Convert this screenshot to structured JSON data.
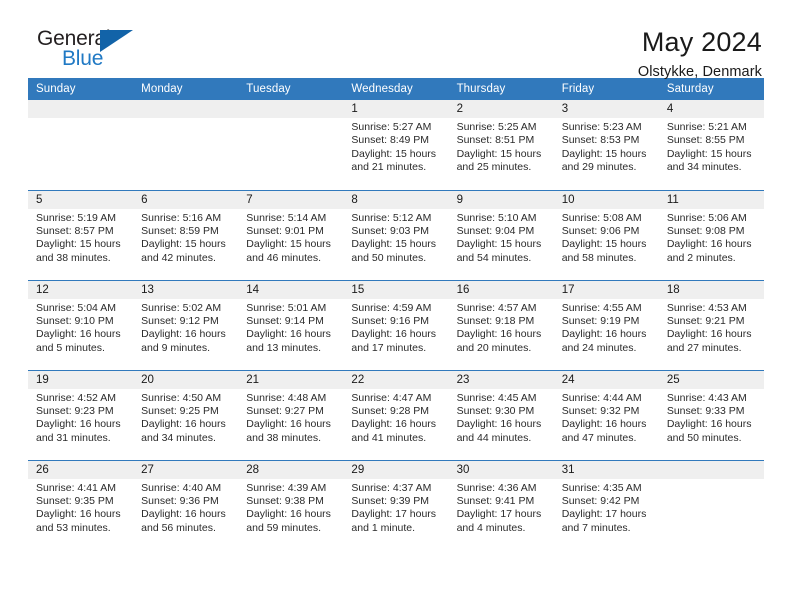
{
  "brand": {
    "word_one": "General",
    "word_two": "Blue",
    "triangle_color": "#1263a8",
    "blue_text_color": "#2079c4"
  },
  "header": {
    "title": "May 2024",
    "subtitle": "Olstykke, Denmark"
  },
  "theme": {
    "header_blue": "#3179bc",
    "daynum_band": "#efefef",
    "row_line": "#3179bc"
  },
  "weekdays": [
    "Sunday",
    "Monday",
    "Tuesday",
    "Wednesday",
    "Thursday",
    "Friday",
    "Saturday"
  ],
  "weeks": [
    [
      {
        "day": "",
        "empty": true
      },
      {
        "day": "",
        "empty": true
      },
      {
        "day": "",
        "empty": true
      },
      {
        "day": "1",
        "sunrise": "Sunrise: 5:27 AM",
        "sunset": "Sunset: 8:49 PM",
        "daylight_1": "Daylight: 15 hours",
        "daylight_2": "and 21 minutes."
      },
      {
        "day": "2",
        "sunrise": "Sunrise: 5:25 AM",
        "sunset": "Sunset: 8:51 PM",
        "daylight_1": "Daylight: 15 hours",
        "daylight_2": "and 25 minutes."
      },
      {
        "day": "3",
        "sunrise": "Sunrise: 5:23 AM",
        "sunset": "Sunset: 8:53 PM",
        "daylight_1": "Daylight: 15 hours",
        "daylight_2": "and 29 minutes."
      },
      {
        "day": "4",
        "sunrise": "Sunrise: 5:21 AM",
        "sunset": "Sunset: 8:55 PM",
        "daylight_1": "Daylight: 15 hours",
        "daylight_2": "and 34 minutes."
      }
    ],
    [
      {
        "day": "5",
        "sunrise": "Sunrise: 5:19 AM",
        "sunset": "Sunset: 8:57 PM",
        "daylight_1": "Daylight: 15 hours",
        "daylight_2": "and 38 minutes."
      },
      {
        "day": "6",
        "sunrise": "Sunrise: 5:16 AM",
        "sunset": "Sunset: 8:59 PM",
        "daylight_1": "Daylight: 15 hours",
        "daylight_2": "and 42 minutes."
      },
      {
        "day": "7",
        "sunrise": "Sunrise: 5:14 AM",
        "sunset": "Sunset: 9:01 PM",
        "daylight_1": "Daylight: 15 hours",
        "daylight_2": "and 46 minutes."
      },
      {
        "day": "8",
        "sunrise": "Sunrise: 5:12 AM",
        "sunset": "Sunset: 9:03 PM",
        "daylight_1": "Daylight: 15 hours",
        "daylight_2": "and 50 minutes."
      },
      {
        "day": "9",
        "sunrise": "Sunrise: 5:10 AM",
        "sunset": "Sunset: 9:04 PM",
        "daylight_1": "Daylight: 15 hours",
        "daylight_2": "and 54 minutes."
      },
      {
        "day": "10",
        "sunrise": "Sunrise: 5:08 AM",
        "sunset": "Sunset: 9:06 PM",
        "daylight_1": "Daylight: 15 hours",
        "daylight_2": "and 58 minutes."
      },
      {
        "day": "11",
        "sunrise": "Sunrise: 5:06 AM",
        "sunset": "Sunset: 9:08 PM",
        "daylight_1": "Daylight: 16 hours",
        "daylight_2": "and 2 minutes."
      }
    ],
    [
      {
        "day": "12",
        "sunrise": "Sunrise: 5:04 AM",
        "sunset": "Sunset: 9:10 PM",
        "daylight_1": "Daylight: 16 hours",
        "daylight_2": "and 5 minutes."
      },
      {
        "day": "13",
        "sunrise": "Sunrise: 5:02 AM",
        "sunset": "Sunset: 9:12 PM",
        "daylight_1": "Daylight: 16 hours",
        "daylight_2": "and 9 minutes."
      },
      {
        "day": "14",
        "sunrise": "Sunrise: 5:01 AM",
        "sunset": "Sunset: 9:14 PM",
        "daylight_1": "Daylight: 16 hours",
        "daylight_2": "and 13 minutes."
      },
      {
        "day": "15",
        "sunrise": "Sunrise: 4:59 AM",
        "sunset": "Sunset: 9:16 PM",
        "daylight_1": "Daylight: 16 hours",
        "daylight_2": "and 17 minutes."
      },
      {
        "day": "16",
        "sunrise": "Sunrise: 4:57 AM",
        "sunset": "Sunset: 9:18 PM",
        "daylight_1": "Daylight: 16 hours",
        "daylight_2": "and 20 minutes."
      },
      {
        "day": "17",
        "sunrise": "Sunrise: 4:55 AM",
        "sunset": "Sunset: 9:19 PM",
        "daylight_1": "Daylight: 16 hours",
        "daylight_2": "and 24 minutes."
      },
      {
        "day": "18",
        "sunrise": "Sunrise: 4:53 AM",
        "sunset": "Sunset: 9:21 PM",
        "daylight_1": "Daylight: 16 hours",
        "daylight_2": "and 27 minutes."
      }
    ],
    [
      {
        "day": "19",
        "sunrise": "Sunrise: 4:52 AM",
        "sunset": "Sunset: 9:23 PM",
        "daylight_1": "Daylight: 16 hours",
        "daylight_2": "and 31 minutes."
      },
      {
        "day": "20",
        "sunrise": "Sunrise: 4:50 AM",
        "sunset": "Sunset: 9:25 PM",
        "daylight_1": "Daylight: 16 hours",
        "daylight_2": "and 34 minutes."
      },
      {
        "day": "21",
        "sunrise": "Sunrise: 4:48 AM",
        "sunset": "Sunset: 9:27 PM",
        "daylight_1": "Daylight: 16 hours",
        "daylight_2": "and 38 minutes."
      },
      {
        "day": "22",
        "sunrise": "Sunrise: 4:47 AM",
        "sunset": "Sunset: 9:28 PM",
        "daylight_1": "Daylight: 16 hours",
        "daylight_2": "and 41 minutes."
      },
      {
        "day": "23",
        "sunrise": "Sunrise: 4:45 AM",
        "sunset": "Sunset: 9:30 PM",
        "daylight_1": "Daylight: 16 hours",
        "daylight_2": "and 44 minutes."
      },
      {
        "day": "24",
        "sunrise": "Sunrise: 4:44 AM",
        "sunset": "Sunset: 9:32 PM",
        "daylight_1": "Daylight: 16 hours",
        "daylight_2": "and 47 minutes."
      },
      {
        "day": "25",
        "sunrise": "Sunrise: 4:43 AM",
        "sunset": "Sunset: 9:33 PM",
        "daylight_1": "Daylight: 16 hours",
        "daylight_2": "and 50 minutes."
      }
    ],
    [
      {
        "day": "26",
        "sunrise": "Sunrise: 4:41 AM",
        "sunset": "Sunset: 9:35 PM",
        "daylight_1": "Daylight: 16 hours",
        "daylight_2": "and 53 minutes."
      },
      {
        "day": "27",
        "sunrise": "Sunrise: 4:40 AM",
        "sunset": "Sunset: 9:36 PM",
        "daylight_1": "Daylight: 16 hours",
        "daylight_2": "and 56 minutes."
      },
      {
        "day": "28",
        "sunrise": "Sunrise: 4:39 AM",
        "sunset": "Sunset: 9:38 PM",
        "daylight_1": "Daylight: 16 hours",
        "daylight_2": "and 59 minutes."
      },
      {
        "day": "29",
        "sunrise": "Sunrise: 4:37 AM",
        "sunset": "Sunset: 9:39 PM",
        "daylight_1": "Daylight: 17 hours",
        "daylight_2": "and 1 minute."
      },
      {
        "day": "30",
        "sunrise": "Sunrise: 4:36 AM",
        "sunset": "Sunset: 9:41 PM",
        "daylight_1": "Daylight: 17 hours",
        "daylight_2": "and 4 minutes."
      },
      {
        "day": "31",
        "sunrise": "Sunrise: 4:35 AM",
        "sunset": "Sunset: 9:42 PM",
        "daylight_1": "Daylight: 17 hours",
        "daylight_2": "and 7 minutes."
      },
      {
        "day": "",
        "empty": true
      }
    ]
  ]
}
